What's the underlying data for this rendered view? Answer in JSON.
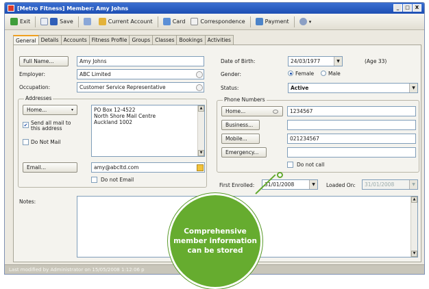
{
  "window": {
    "title": "[Metro Fitness] Member: Amy  Johns",
    "controls": [
      "_",
      "□",
      "X"
    ]
  },
  "toolbar": {
    "exit": "Exit",
    "save": "Save",
    "current_account": "Current Account",
    "card": "Card",
    "correspondence": "Correspondence",
    "payment": "Payment"
  },
  "tabs": [
    "General",
    "Details",
    "Accounts",
    "Fitness Profile",
    "Groups",
    "Classes",
    "Bookings",
    "Activities"
  ],
  "left": {
    "full_name_button": "Full Name...",
    "full_name_value": "Amy  Johns",
    "employer_label": "Employer:",
    "employer_value": "ABC Limited",
    "occupation_label": "Occupation:",
    "occupation_value": "Customer Service Representative",
    "addresses_title": "Addresses",
    "home_button": "Home...",
    "send_all_mail": "Send all mail to this address",
    "do_not_mail": "Do Not Mail",
    "address_lines": [
      "PO Box 12-4522",
      "North Shore Mail Centre",
      "Auckland 1002"
    ],
    "email_button": "Email...",
    "email_value": "amy@abcltd.com",
    "do_not_email": "Do not Email",
    "notes_label": "Notes:"
  },
  "right": {
    "dob_label": "Date of Birth:",
    "dob_value": "24/03/1977",
    "age": "(Age 33)",
    "gender_label": "Gender:",
    "gender_female": "Female",
    "gender_male": "Male",
    "status_label": "Status:",
    "status_value": "Active",
    "phone_title": "Phone Numbers",
    "home_button": "Home...",
    "home_value": "1234567",
    "business_button": "Business...",
    "business_value": "",
    "mobile_button": "Mobile...",
    "mobile_value": "021234567",
    "emergency_button": "Emergency...",
    "emergency_value": "",
    "do_not_call": "Do not call",
    "first_enrolled_label": "First Enrolled:",
    "first_enrolled_value": "31/01/2008",
    "loaded_on_label": "Loaded On:",
    "loaded_on_value": "31/01/2008"
  },
  "status_bar": "Last modified by Administrator on 15/05/2008 1:12:06 p",
  "callout": {
    "lines": [
      "Comprehensive",
      "member information",
      "can be stored"
    ]
  },
  "colors": {
    "title_bar": "#2a5fc4",
    "callout_green": "#66ac2f",
    "active_tab_accent": "#f0a020"
  }
}
